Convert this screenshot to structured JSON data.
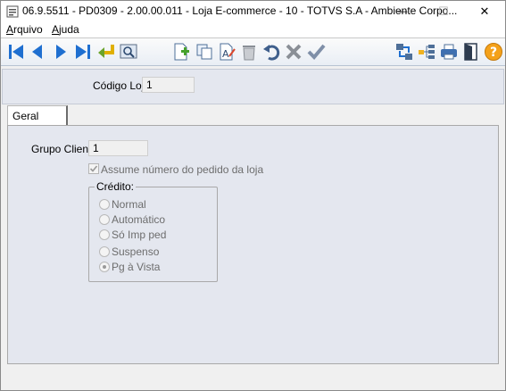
{
  "window": {
    "title": "06.9.5511 - PD0309 - 2.00.00.011 - Loja E-commerce - 10 - TOTVS S.A - Ambiente Corpo...",
    "minimize_glyph": "—",
    "maximize_glyph": "☐",
    "close_glyph": "✕"
  },
  "menu": {
    "items": [
      {
        "label": "Arquivo",
        "underline_char": "A"
      },
      {
        "label": "Ajuda",
        "underline_char": "A"
      }
    ]
  },
  "toolbar": {
    "buttons": [
      {
        "icon": "first-record-icon"
      },
      {
        "icon": "previous-record-icon"
      },
      {
        "icon": "next-record-icon"
      },
      {
        "icon": "last-record-icon"
      },
      {
        "icon": "go-to-icon"
      },
      {
        "icon": "search-icon"
      },
      {
        "icon": "add-icon"
      },
      {
        "icon": "copy-icon"
      },
      {
        "icon": "edit-icon"
      },
      {
        "icon": "delete-icon"
      },
      {
        "icon": "undo-icon"
      },
      {
        "icon": "cancel-icon"
      },
      {
        "icon": "save-icon"
      },
      {
        "icon": "navigate-icon"
      },
      {
        "icon": "tree-icon"
      },
      {
        "icon": "print-icon"
      },
      {
        "icon": "exit-icon"
      },
      {
        "icon": "help-icon"
      }
    ]
  },
  "header": {
    "codigo_loja_label": "Código Loja:",
    "codigo_loja_value": "1"
  },
  "tabs": [
    {
      "label": "Geral",
      "active": true
    }
  ],
  "geral": {
    "grupo_cliente_label": "Grupo Cliente:",
    "grupo_cliente_value": "1",
    "assume_numero_label": "Assume número do pedido da loja",
    "assume_numero_checked": true,
    "credito": {
      "legend": "Crédito:",
      "options": [
        {
          "label": "Normal",
          "selected": false
        },
        {
          "label": "Automático",
          "selected": false
        },
        {
          "label": "Só Imp ped",
          "selected": false
        },
        {
          "label": "Suspenso",
          "selected": false
        },
        {
          "label": "Pg à Vista",
          "selected": true
        }
      ]
    }
  },
  "colors": {
    "panel_bg": "#e4e7ef",
    "toolbar_bg": "#e9eef5",
    "nav_blue": "#1f6fd0",
    "help_orange": "#f4a11a"
  }
}
